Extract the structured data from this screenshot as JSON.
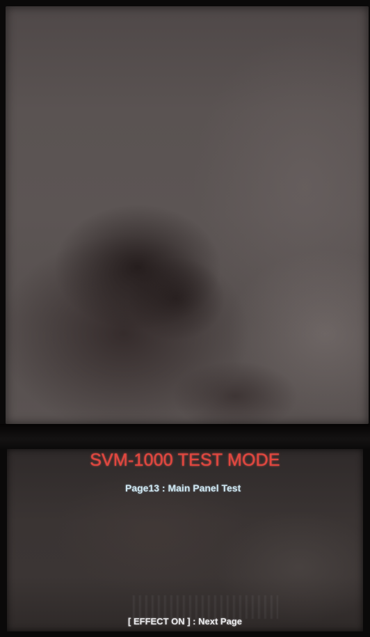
{
  "screen": {
    "title": "SVM-1000 TEST MODE",
    "page_line": "Page13 : Main Panel Test",
    "hint": "[ EFFECT ON ] : Next Page"
  },
  "colors": {
    "title": "#e2453d",
    "page_line": "#cfe6f0",
    "hint": "#e8e8ea",
    "bezel": "#0a0909"
  }
}
